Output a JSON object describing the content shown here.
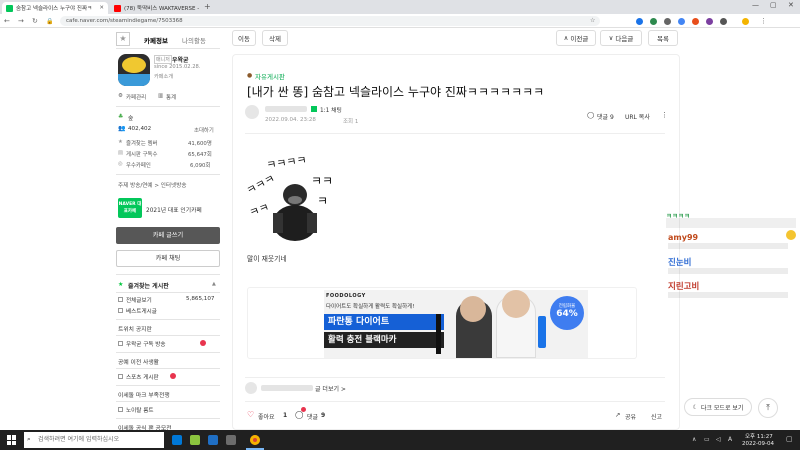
{
  "browser": {
    "tabs": [
      {
        "title": "숨참고 넥슬라이스 누구야 진짜ㅋ",
        "favicon_color": "#03c75a"
      },
      {
        "title": "(78) 뚝딱비스 WAKTAVERSE - You",
        "favicon_color": "#ff0000"
      }
    ],
    "new_tab": "+",
    "url": "cafe.naver.com/steamindiegame/7503368"
  },
  "sidebar": {
    "tab_cafe_info": "카페정보",
    "tab_my_activity": "나의활동",
    "grade_label": "매니저",
    "manager_name": "우왁굳",
    "since": "since 2015.02.28.",
    "cafe_intro": "카페소개",
    "cafe_manage": "카페관리",
    "stats": "통계",
    "level_name": "숲",
    "member_count": "402,402",
    "invite": "초대하기",
    "fav_members_label": "즐겨찾는 멤버",
    "fav_members_value": "41,600명",
    "subscribers_label": "게시판 구독수",
    "subscribers_value": "65,647회",
    "best_label": "우수카페인",
    "best_value": "6,090회",
    "topic": "주제 방송/연예 > 인터넷방송",
    "badge_text": "NAVER 대표카페",
    "badge_caption": "2021년 대표 인기카페",
    "write_button": "카페 글쓰기",
    "chat_button": "카페 채팅",
    "favorites_title": "즐겨찾는 게시판",
    "menu": [
      {
        "label": "전체글보기",
        "count": "5,865,107"
      },
      {
        "label": "베스트게시글",
        "count": ""
      },
      {
        "label": "트위치 공지란",
        "count": ""
      },
      {
        "label": "우왁굳 구독 방송",
        "count": ""
      },
      {
        "label": "공예 이전 사생활",
        "count": ""
      },
      {
        "label": "스포츠 게시판",
        "count": ""
      },
      {
        "label": "이세돌 마크 부족전쟁",
        "count": ""
      },
      {
        "label": "노이탈 룸트",
        "count": ""
      },
      {
        "label": "이세돌 공식 팬 공모전",
        "count": ""
      }
    ]
  },
  "toolbar": {
    "move": "이동",
    "delete": "삭제",
    "prev": "이전글",
    "next": "다음글",
    "list": "목록"
  },
  "article": {
    "board": "자유게시판",
    "title": "[내가 싼 똥] 숨참고 넥슬라이스 누구야 진짜ㅋㅋㅋㅋㅋㅋㅋ",
    "chat_label": "1:1 채팅",
    "date": "2022.09.04. 23:28",
    "views_label": "조회 1",
    "comments_label": "댓글 9",
    "url_copy": "URL 복사",
    "body_text": "말이 재웃기네",
    "ad_brand": "FOODOLOGY",
    "ad_copy": "다이어트도 확실하게 활력도 확실하게!",
    "ad_headline": "파란통 다이어트",
    "ad_subheadline": "활력 충전 블랙마카",
    "ad_badge_top": "전립화율",
    "ad_badge_value": "64%",
    "author_posts": "글 더보기 >",
    "like_label": "좋아요",
    "like_count": "1",
    "comment_label": "댓글",
    "comment_count": "9",
    "share_label": "공유",
    "report_label": "신고"
  },
  "chat_overlay": [
    {
      "text": "ㅋㅋㅋㅋ",
      "color": "#3aa35a"
    },
    {
      "text": "amy99",
      "color": "#c04a1c"
    },
    {
      "text": "진눈비",
      "color": "#2e6bd3"
    },
    {
      "text": "지린고비",
      "color": "#c0392b"
    }
  ],
  "dark_mode_button": "다크 모드로 보기",
  "taskbar": {
    "search_placeholder": "검색하려면 여기에 입력하십시오",
    "time": "오후 11:27",
    "date": "2022-09-04"
  },
  "colors": {
    "naver_green": "#03c75a",
    "accent_green": "#00c73c",
    "like_red": "#e8344e",
    "taskbar": "#202020"
  }
}
